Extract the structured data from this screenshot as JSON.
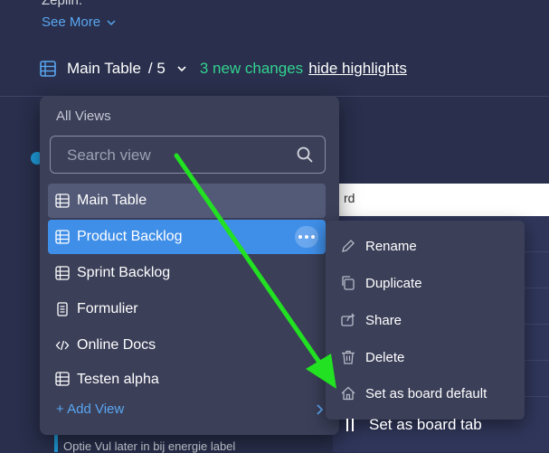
{
  "header": {
    "truncated_text": "Zeplin.",
    "see_more": "See More",
    "table_title": "Main Table",
    "view_count": "/ 5",
    "changes": "3 new changes",
    "hide_highlights": "hide highlights"
  },
  "board": {
    "strip_text": "rd",
    "bottom_text": "Optie Vul later in bij energie label"
  },
  "dropdown": {
    "heading": "All Views",
    "search_placeholder": "Search view",
    "items": [
      {
        "label": "Main Table",
        "icon": "table-icon"
      },
      {
        "label": "Product Backlog",
        "icon": "table-icon"
      },
      {
        "label": "Sprint Backlog",
        "icon": "table-icon"
      },
      {
        "label": "Formulier",
        "icon": "form-icon"
      },
      {
        "label": "Online Docs",
        "icon": "code-icon"
      },
      {
        "label": "Testen alpha",
        "icon": "table-icon"
      }
    ],
    "add_view": "+ Add View"
  },
  "context_menu": {
    "items": [
      {
        "label": "Rename",
        "icon": "pencil-icon"
      },
      {
        "label": "Duplicate",
        "icon": "duplicate-icon"
      },
      {
        "label": "Share",
        "icon": "share-icon"
      },
      {
        "label": "Delete",
        "icon": "trash-icon"
      },
      {
        "label": "Set as board default",
        "icon": "home-icon"
      }
    ],
    "tab_item": "Set as board tab"
  },
  "colors": {
    "accent": "#3f8fe8",
    "changes": "#33d391",
    "arrow": "#22e022",
    "background": "#292f4c"
  }
}
